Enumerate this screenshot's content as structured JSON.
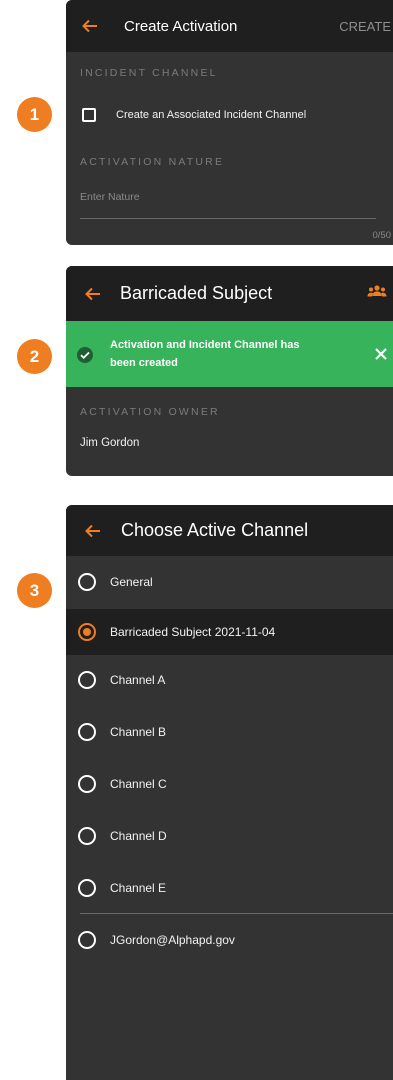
{
  "steps": [
    "1",
    "2",
    "3"
  ],
  "colors": {
    "accent": "#ef7d22",
    "success": "#37b35b",
    "panel": "#333333",
    "header": "#1f1f1f"
  },
  "panel1": {
    "title": "Create Activation",
    "create_label": "CREATE",
    "incident_section": "INCIDENT CHANNEL",
    "checkbox_label": "Create an Associated Incident Channel",
    "checkbox_checked": false,
    "nature_section": "ACTIVATION NATURE",
    "nature_placeholder": "Enter Nature",
    "nature_counter": "0/50"
  },
  "panel2": {
    "title": "Barricaded Subject",
    "banner_line1": "Activation and Incident Channel has",
    "banner_line2": "been created",
    "owner_section": "ACTIVATION OWNER",
    "owner_name": "Jim Gordon"
  },
  "panel3": {
    "title": "Choose Active Channel",
    "channels": [
      {
        "label": "General",
        "selected": false
      },
      {
        "label": "Barricaded Subject 2021-11-04",
        "selected": true
      },
      {
        "label": "Channel A",
        "selected": false
      },
      {
        "label": "Channel B",
        "selected": false
      },
      {
        "label": "Channel C",
        "selected": false
      },
      {
        "label": "Channel D",
        "selected": false
      },
      {
        "label": "Channel E",
        "selected": false
      },
      {
        "label": "JGordon@Alphapd.gov",
        "selected": false
      }
    ]
  },
  "icons": {
    "back": "arrow-left-icon",
    "people": "group-people-icon",
    "success": "check-circle-icon",
    "close": "close-icon"
  }
}
